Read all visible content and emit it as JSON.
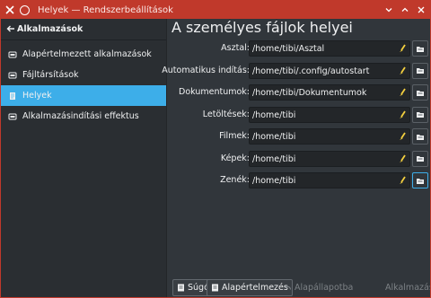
{
  "window": {
    "title": "Helyek — Rendszerbeállítások"
  },
  "sidebar": {
    "back_label": "Alkalmazások",
    "items": [
      {
        "label": "Alapértelmezett alkalmazások",
        "icon": "app-icon"
      },
      {
        "label": "Fájltársítások",
        "icon": "app-icon"
      },
      {
        "label": "Helyek",
        "icon": "document-icon",
        "active": true
      },
      {
        "label": "Alkalmazásindítási effektus",
        "icon": "app-icon"
      }
    ]
  },
  "main": {
    "title": "A személyes fájlok helyei",
    "rows": [
      {
        "label": "Asztal:",
        "value": "/home/tibi/Asztal"
      },
      {
        "label": "Automatikus indítás:",
        "value": "/home/tibi/.config/autostart"
      },
      {
        "label": "Dokumentumok:",
        "value": "/home/tibi/Dokumentumok"
      },
      {
        "label": "Letöltések:",
        "value": "/home/tibi"
      },
      {
        "label": "Filmek:",
        "value": "/home/tibi"
      },
      {
        "label": "Képek:",
        "value": "/home/tibi"
      },
      {
        "label": "Zenék:",
        "value": "/home/tibi"
      }
    ]
  },
  "buttons": {
    "help": "Súgó",
    "defaults": "Alapértelmezés",
    "reset": "Alapállapotba",
    "apply": "Alkalmazás"
  },
  "colors": {
    "titlebar": "#c0392b",
    "selection": "#3daee9",
    "background": "#31363b",
    "field": "#232629"
  }
}
